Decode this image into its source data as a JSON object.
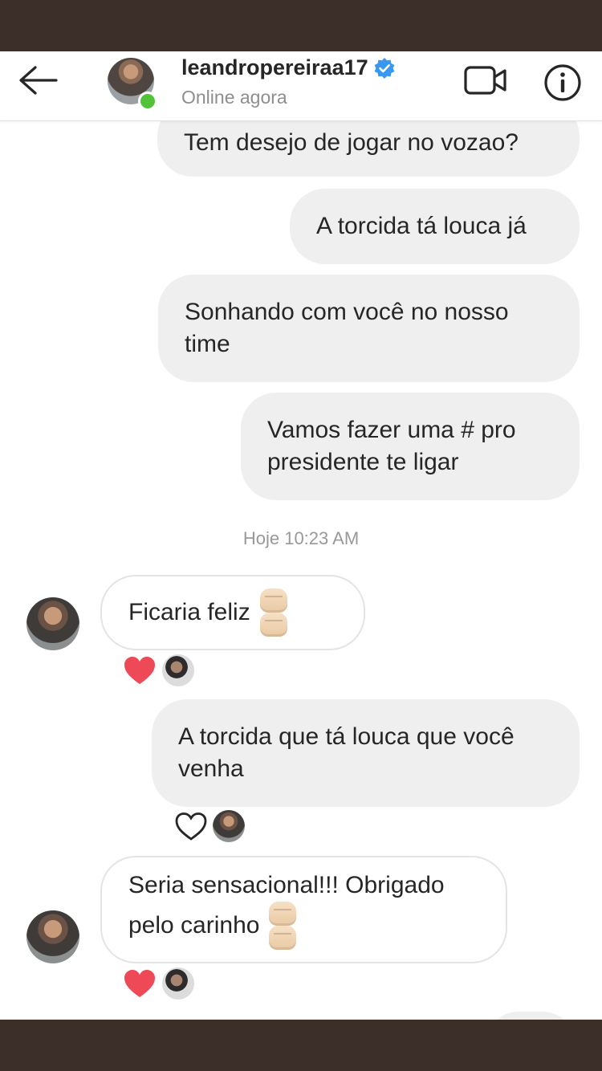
{
  "header": {
    "username": "leandropereiraa17",
    "status": "Online agora"
  },
  "messages": {
    "m1": "Tem desejo de jogar no vozao?",
    "m2": "A torcida tá louca já",
    "m3_line1": "Sonhando com você no nosso",
    "m3_line2": "time",
    "m4_line1": "Vamos fazer uma # pro",
    "m4_line2": "presidente te ligar",
    "timestamp": "Hoje 10:23 AM",
    "r1": "Ficaria feliz",
    "m5_line1": "A torcida que tá louca que você",
    "m5_line2": "venha",
    "r2_line1": "Seria sensacional!!! Obrigado",
    "r2_line2": "pelo carinho"
  },
  "icons": {
    "back": "arrow-left-icon",
    "verified": "verified-badge-icon",
    "video": "video-camera-icon",
    "info": "info-icon",
    "heart_filled": "heart-filled-icon",
    "heart_outline": "heart-outline-icon",
    "fist": "oncoming-fist-emoji"
  },
  "colors": {
    "verified_blue": "#3897f0",
    "online_green": "#52c23a",
    "heart_red": "#ed4956",
    "sent_bubble": "#efefef"
  }
}
